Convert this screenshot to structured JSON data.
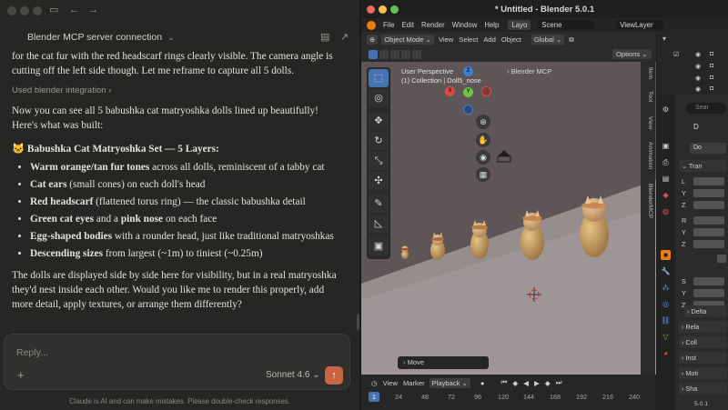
{
  "claude": {
    "conversation_title": "Blender MCP server connection",
    "fragment": "for the cat fur with the red headscarf rings clearly visible. The camera angle is cutting off the left side though. Let me reframe to capture all 5 dolls.",
    "tool_used": "Used blender integration",
    "p1": "Now you can see all 5 babushka cat matryoshka dolls lined up beautifully! Here's what was built:",
    "heading_emoji": "🐱",
    "heading": "Babushka Cat Matryoshka Set — 5 Layers:",
    "list": [
      {
        "bold": "Warm orange/tan fur tones",
        "rest": " across all dolls, reminiscent of a tabby cat"
      },
      {
        "bold": "Cat ears",
        "rest": " (small cones) on each doll's head"
      },
      {
        "bold": "Red headscarf",
        "rest": " (flattened torus ring) — the classic babushka detail"
      },
      {
        "bold": "Green cat eyes",
        "rest": " and a "
      },
      {
        "bold": "Egg-shaped bodies",
        "rest": " with a rounder head, just like traditional matryoshkas"
      },
      {
        "bold": "Descending sizes",
        "rest": " from largest (~1m) to tiniest (~0.25m)"
      }
    ],
    "list_item4_bold2": "pink nose",
    "list_item4_rest2": " on each face",
    "p2": "The dolls are displayed side by side here for visibility, but in a real matryoshka they'd nest inside each other. Would you like me to render this properly, add more detail, apply textures, or arrange them differently?",
    "input_placeholder": "Reply...",
    "model": "Sonnet 4.6",
    "disclaimer": "Claude is AI and can make mistakes. Please double-check responses."
  },
  "blender": {
    "window_title": "* Untitled - Blender 5.0.1",
    "menu": [
      "File",
      "Edit",
      "Render",
      "Window",
      "Help"
    ],
    "workspace_tab": "Layo",
    "scene": "Scene",
    "view_layer": "ViewLayer",
    "mode": "Object Mode",
    "vp_menu": [
      "View",
      "Select",
      "Add",
      "Object"
    ],
    "orientation": "Global",
    "options": "Options",
    "overlay_line1": "User Perspective",
    "overlay_line2": "(1) Collection | Doll5_nose",
    "mcp_panel": "Blender MCP",
    "side_tabs": [
      "Item",
      "Tool",
      "View",
      "Animation",
      "BlenderMCP"
    ],
    "last_operator": "Move",
    "timeline_menu": [
      "View",
      "Marker",
      "Playback"
    ],
    "current_frame": "1",
    "frame_numbers": [
      "24",
      "48",
      "72",
      "96",
      "120",
      "144",
      "168",
      "192",
      "216",
      "240"
    ],
    "props_panels": [
      "Tran",
      "Delta",
      "Rela",
      "Coll",
      "Inst",
      "Moti",
      "Sha"
    ],
    "props_object": "Do",
    "props_search": "Sear",
    "props_d": "D",
    "axes_loc": [
      "L",
      "Y",
      "Z"
    ],
    "axes_rot": [
      "R",
      "Y",
      "Z"
    ],
    "axes_scale": [
      "S",
      "Y",
      "Z"
    ],
    "version": "5.0.1"
  }
}
